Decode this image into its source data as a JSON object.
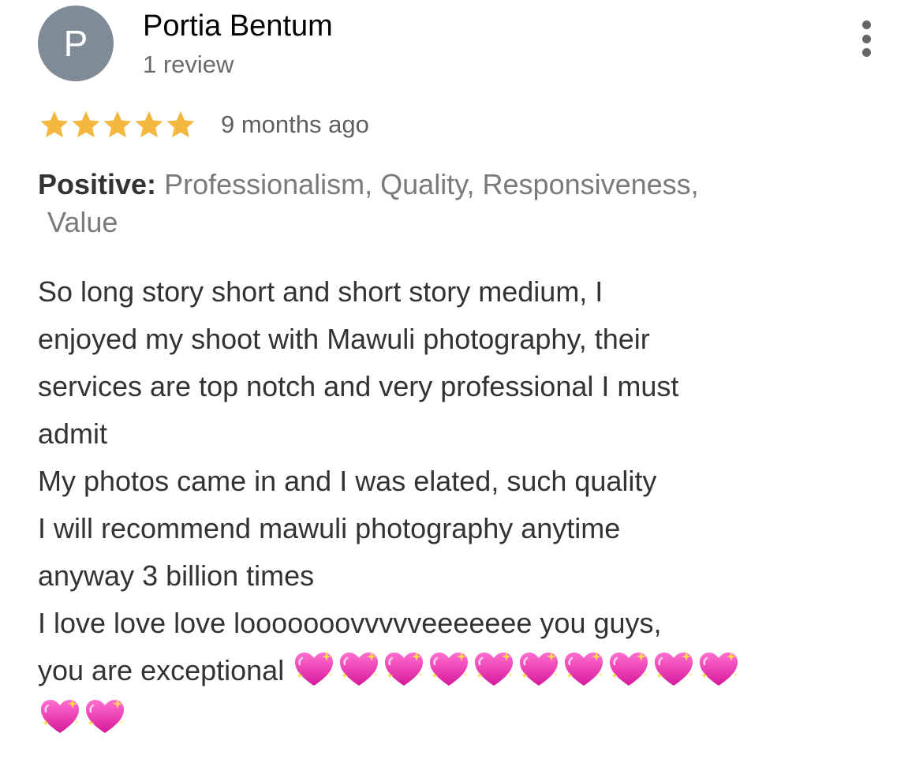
{
  "author": {
    "avatar_letter": "P",
    "avatar_color": "#7f8c97",
    "name": "Portia Bentum",
    "review_count": "1 review"
  },
  "more_menu": {
    "icon": "more-vert-icon"
  },
  "rating": {
    "stars": 5,
    "max_stars": 5,
    "star_color": "#f4b740",
    "date": "9 months ago"
  },
  "aspects": {
    "label": "Positive:",
    "line1": "Professionalism, Quality, Responsiveness,",
    "line2": "Value"
  },
  "review": {
    "lines": [
      "So long story short and short story medium, I",
      "enjoyed my shoot with Mawuli photography, their",
      "services are top notch and very professional I must",
      "admit",
      "My photos came in and I was elated, such quality",
      "I will recommend mawuli photography anytime",
      "anyway 3 billion times",
      "I love love love looooooovvvvveeeeeee you guys,",
      "you are exceptional"
    ],
    "emoji": "sparkling-heart-icon",
    "emoji_count_line1": 10,
    "emoji_count_line2": 2
  }
}
